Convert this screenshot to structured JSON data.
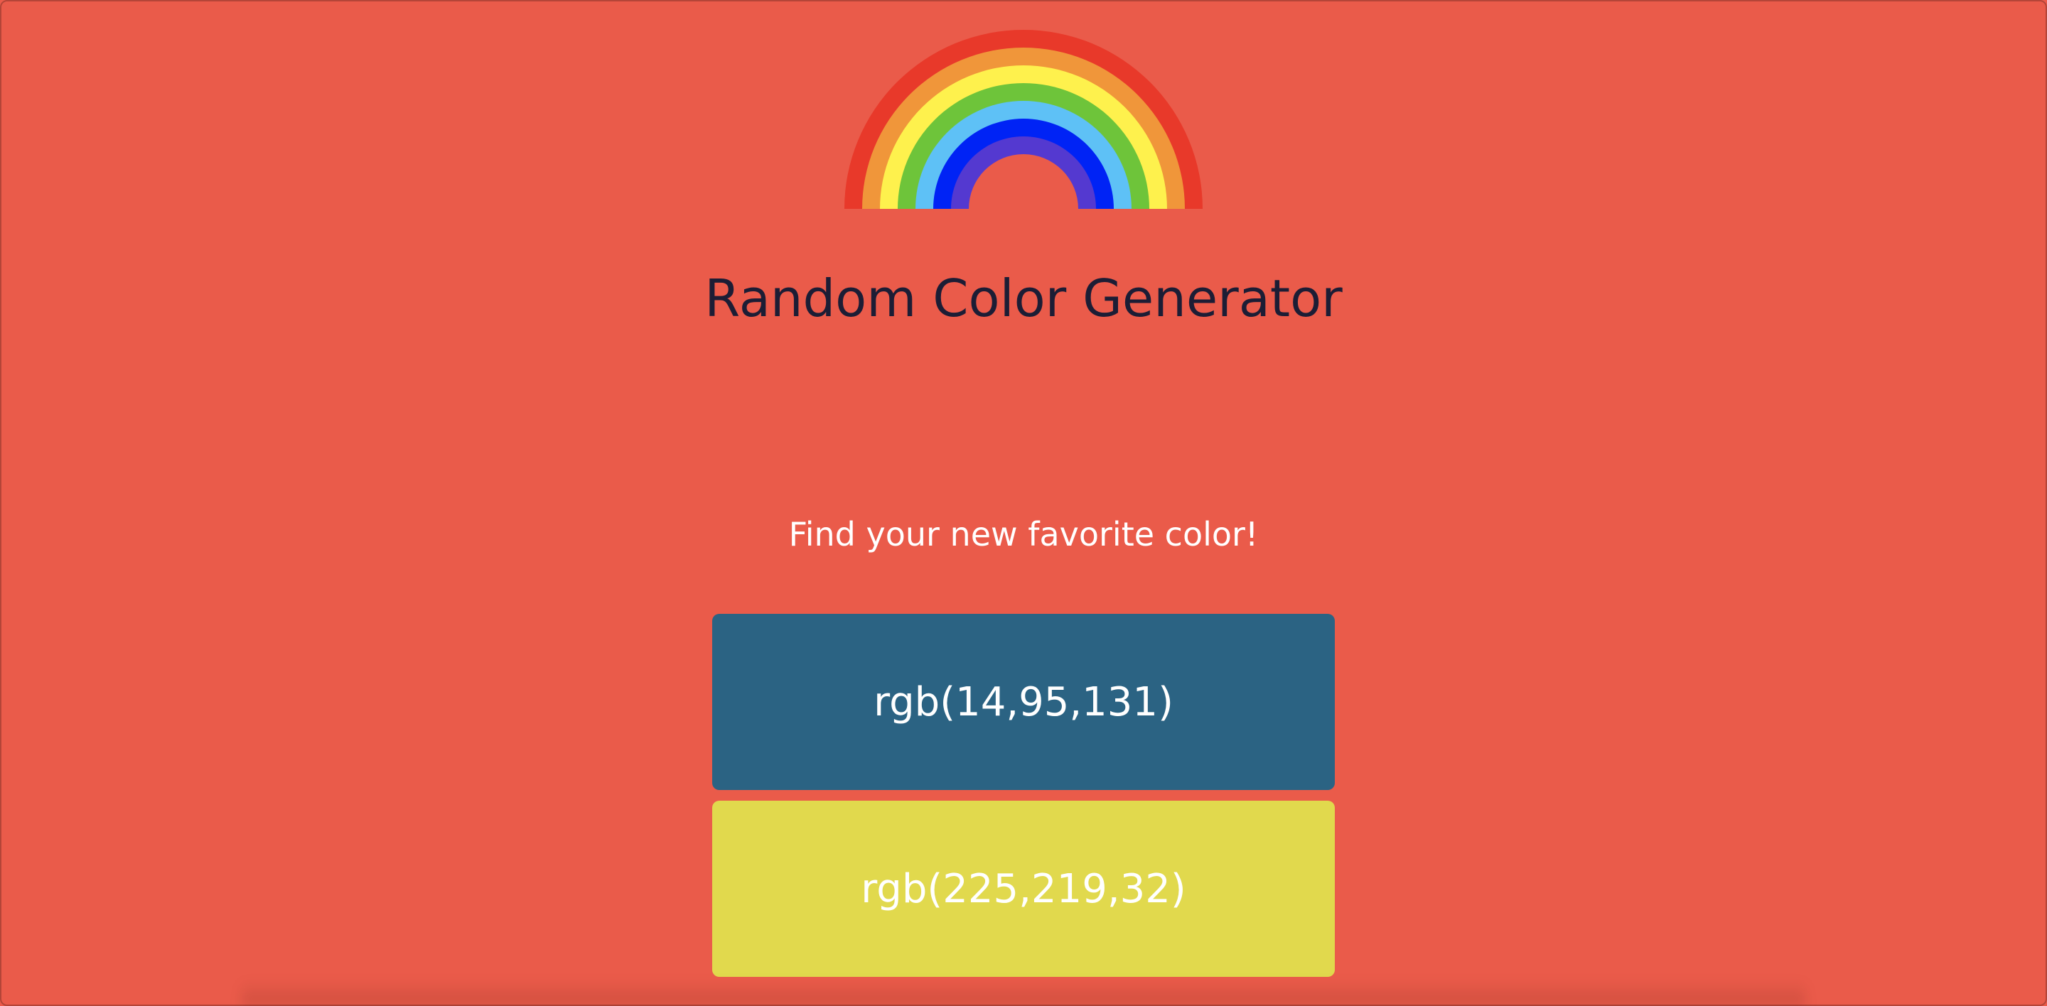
{
  "page": {
    "background_color": "#ea5b4a",
    "title": "Random Color Generator",
    "subtitle": "Find your new favorite color!"
  },
  "rainbow": {
    "icon": "rainbow-icon",
    "colors": [
      "#e8392a",
      "#f0963a",
      "#fef14d",
      "#6ec43a",
      "#5ec1f6",
      "#0023f5",
      "#5439d0"
    ]
  },
  "swatches": [
    {
      "label": "rgb(14,95,131)",
      "color": "#2b6383"
    },
    {
      "label": "rgb(225,219,32)",
      "color": "#e1d94d"
    }
  ]
}
